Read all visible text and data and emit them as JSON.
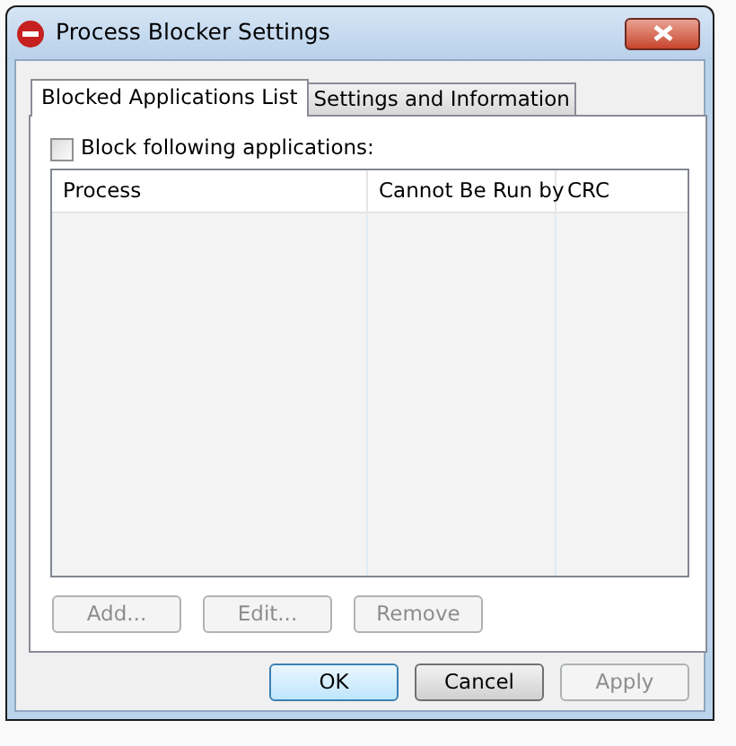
{
  "window": {
    "title": "Process Blocker Settings"
  },
  "tabs": [
    {
      "label": "Blocked Applications List",
      "selected": true
    },
    {
      "label": "Settings and Information",
      "selected": false
    }
  ],
  "block_checkbox": {
    "label": "Block following applications:",
    "checked": false
  },
  "table": {
    "columns": [
      "Process",
      "Cannot Be Run by",
      "CRC"
    ]
  },
  "list_buttons": [
    {
      "label": "Add...",
      "disabled": true
    },
    {
      "label": "Edit...",
      "disabled": true
    },
    {
      "label": "Remove",
      "disabled": true
    }
  ],
  "dialog_buttons": [
    {
      "label": "OK",
      "disabled": false,
      "default": true
    },
    {
      "label": "Cancel",
      "disabled": false,
      "default": false
    },
    {
      "label": "Apply",
      "disabled": true,
      "default": false
    }
  ]
}
